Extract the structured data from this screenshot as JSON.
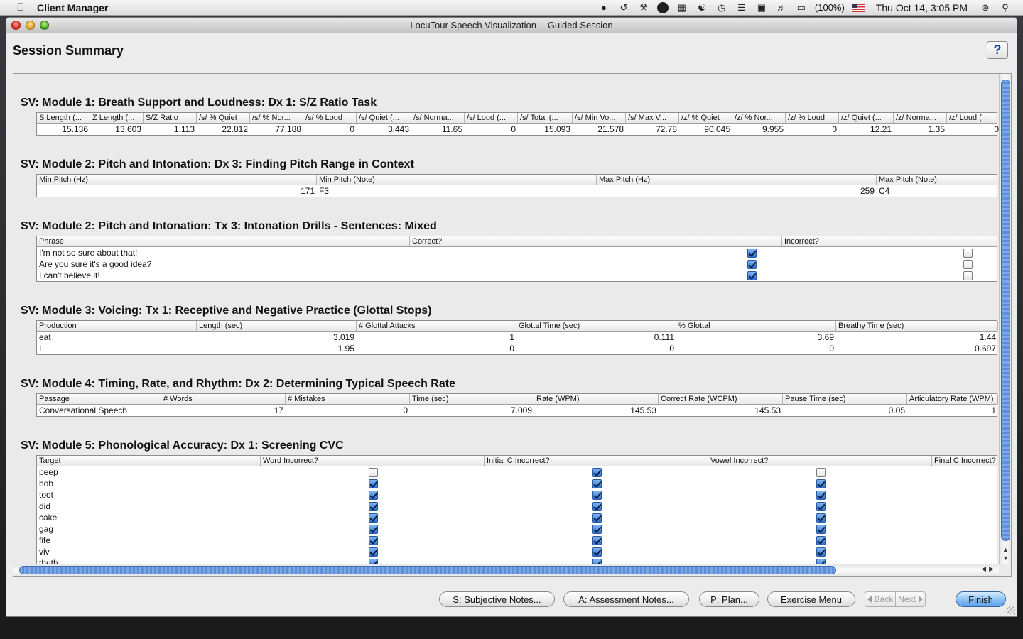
{
  "menubar": {
    "app_name": "Client Manager",
    "battery": "(100%)",
    "clock": "Thu Oct 14,  3:05 PM"
  },
  "window": {
    "title": "LocuTour Speech Visualization -- Guided Session",
    "page_title": "Session Summary",
    "help_label": "?"
  },
  "sections": [
    {
      "title": "SV: Module 1: Breath Support and Loudness: Dx 1: S/Z Ratio Task",
      "headers": [
        "S Length (...",
        "Z Length (...",
        "S/Z Ratio",
        "/s/ % Quiet",
        "/s/ % Nor...",
        "/s/ % Loud",
        "/s/ Quiet (...",
        "/s/ Norma...",
        "/s/ Loud (...",
        "/s/ Total (...",
        "/s/ Min Vo...",
        "/s/ Max V...",
        "/z/ % Quiet",
        "/z/ % Nor...",
        "/z/ % Loud",
        "/z/ Quiet (...",
        "/z/ Norma...",
        "/z/ Loud (..."
      ],
      "rows": [
        [
          "15.136",
          "13.603",
          "1.113",
          "22.812",
          "77.188",
          "0",
          "3.443",
          "11.65",
          "0",
          "15.093",
          "21.578",
          "72.78",
          "90.045",
          "9.955",
          "0",
          "12.21",
          "1.35",
          "0"
        ]
      ]
    },
    {
      "title": "SV: Module 2: Pitch and Intonation: Dx 3: Finding Pitch Range in Context",
      "headers": [
        "Min Pitch (Hz)",
        "Min Pitch (Note)",
        "Max Pitch (Hz)",
        "Max Pitch (Note)"
      ],
      "rows": [
        [
          "171",
          "F3",
          "259",
          "C4"
        ]
      ]
    },
    {
      "title": "SV: Module 2: Pitch and Intonation: Tx 3: Intonation Drills - Sentences: Mixed",
      "headers": [
        "Phrase",
        "Correct?",
        "Incorrect?"
      ],
      "rows": [
        [
          "I'm not so sure about that!",
          true,
          false
        ],
        [
          "Are you sure it's a good idea?",
          true,
          false
        ],
        [
          "I can't believe it!",
          true,
          false
        ]
      ]
    },
    {
      "title": "SV: Module 3: Voicing: Tx 1: Receptive and Negative Practice (Glottal Stops)",
      "headers": [
        "Production",
        "Length (sec)",
        "# Glottal Attacks",
        "Glottal Time (sec)",
        "% Glottal",
        "Breathy Time (sec)"
      ],
      "rows": [
        [
          "eat",
          "3.019",
          "1",
          "0.111",
          "3.69",
          "1.44"
        ],
        [
          "I",
          "1.95",
          "0",
          "0",
          "0",
          "0.697"
        ]
      ]
    },
    {
      "title": "SV: Module 4: Timing, Rate, and Rhythm: Dx 2: Determining Typical Speech Rate",
      "headers": [
        "Passage",
        "# Words",
        "# Mistakes",
        "Time (sec)",
        "Rate (WPM)",
        "Correct Rate (WCPM)",
        "Pause Time (sec)",
        "Articulatory Rate (WPM)"
      ],
      "rows": [
        [
          "Conversational Speech",
          "17",
          "0",
          "7.009",
          "145.53",
          "145.53",
          "0.05",
          "1"
        ]
      ]
    },
    {
      "title": "SV: Module 5: Phonological Accuracy: Dx 1: Screening CVC",
      "headers": [
        "Target",
        "Word Incorrect?",
        "Initial C Incorrect?",
        "Vowel Incorrect?",
        "Final C Incorrect?"
      ],
      "rows": [
        [
          "peep",
          false,
          true,
          false
        ],
        [
          "bob",
          true,
          true,
          true
        ],
        [
          "toot",
          true,
          true,
          true
        ],
        [
          "did",
          true,
          true,
          true
        ],
        [
          "cake",
          true,
          true,
          true
        ],
        [
          "gag",
          true,
          true,
          true
        ],
        [
          "fife",
          true,
          true,
          true
        ],
        [
          "viv",
          true,
          true,
          true
        ],
        [
          "thuth",
          true,
          true,
          true
        ]
      ]
    }
  ],
  "footer": {
    "subjective": "S: Subjective Notes...",
    "assessment": "A: Assessment Notes...",
    "plan": "P: Plan...",
    "exercise_menu": "Exercise Menu",
    "back": "Back",
    "next": "Next",
    "finish": "Finish"
  },
  "colors": {
    "accent": "#2a6fd2",
    "scroll_thumb": "#6b9ce0"
  }
}
